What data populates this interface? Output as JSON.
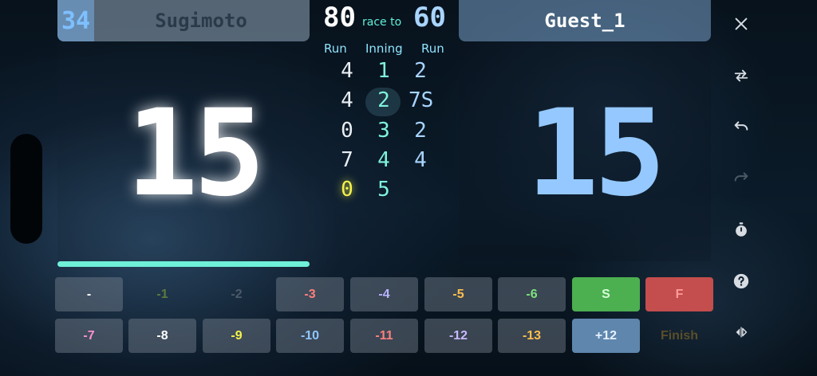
{
  "player1": {
    "average": "34",
    "name": "Sugimoto",
    "score": "15",
    "race_to": "80"
  },
  "player2": {
    "name": "Guest_1",
    "score": "15",
    "race_to": "60"
  },
  "race_label": "race to",
  "column_headers": {
    "run_left": "Run",
    "inning": "Inning",
    "run_right": "Run"
  },
  "innings": [
    {
      "p1": "4",
      "inning": "1",
      "p2": "2"
    },
    {
      "p1": "4",
      "inning": "2",
      "p2": "7S"
    },
    {
      "p1": "0",
      "inning": "3",
      "p2": "2"
    },
    {
      "p1": "7",
      "inning": "4",
      "p2": "4"
    },
    {
      "p1": "0",
      "inning": "5",
      "p2": ""
    }
  ],
  "keypad": {
    "row1": [
      "-",
      "-1",
      "-2",
      "-3",
      "-4",
      "-5",
      "-6",
      "S",
      "F"
    ],
    "row2": [
      "-7",
      "-8",
      "-9",
      "-10",
      "-11",
      "-12",
      "-13",
      "+12",
      "Finish"
    ]
  },
  "toolbar_icons": [
    "close-icon",
    "swap-icon",
    "undo-icon",
    "redo-icon",
    "timer-icon",
    "help-icon",
    "split-view-icon"
  ],
  "colors": {
    "accent_teal": "#6ff0d8",
    "player2_blue": "#94c8ff",
    "highlight_yellow": "#f4f24a",
    "save_green": "#4caf50",
    "foul_red": "#c44d4d"
  }
}
